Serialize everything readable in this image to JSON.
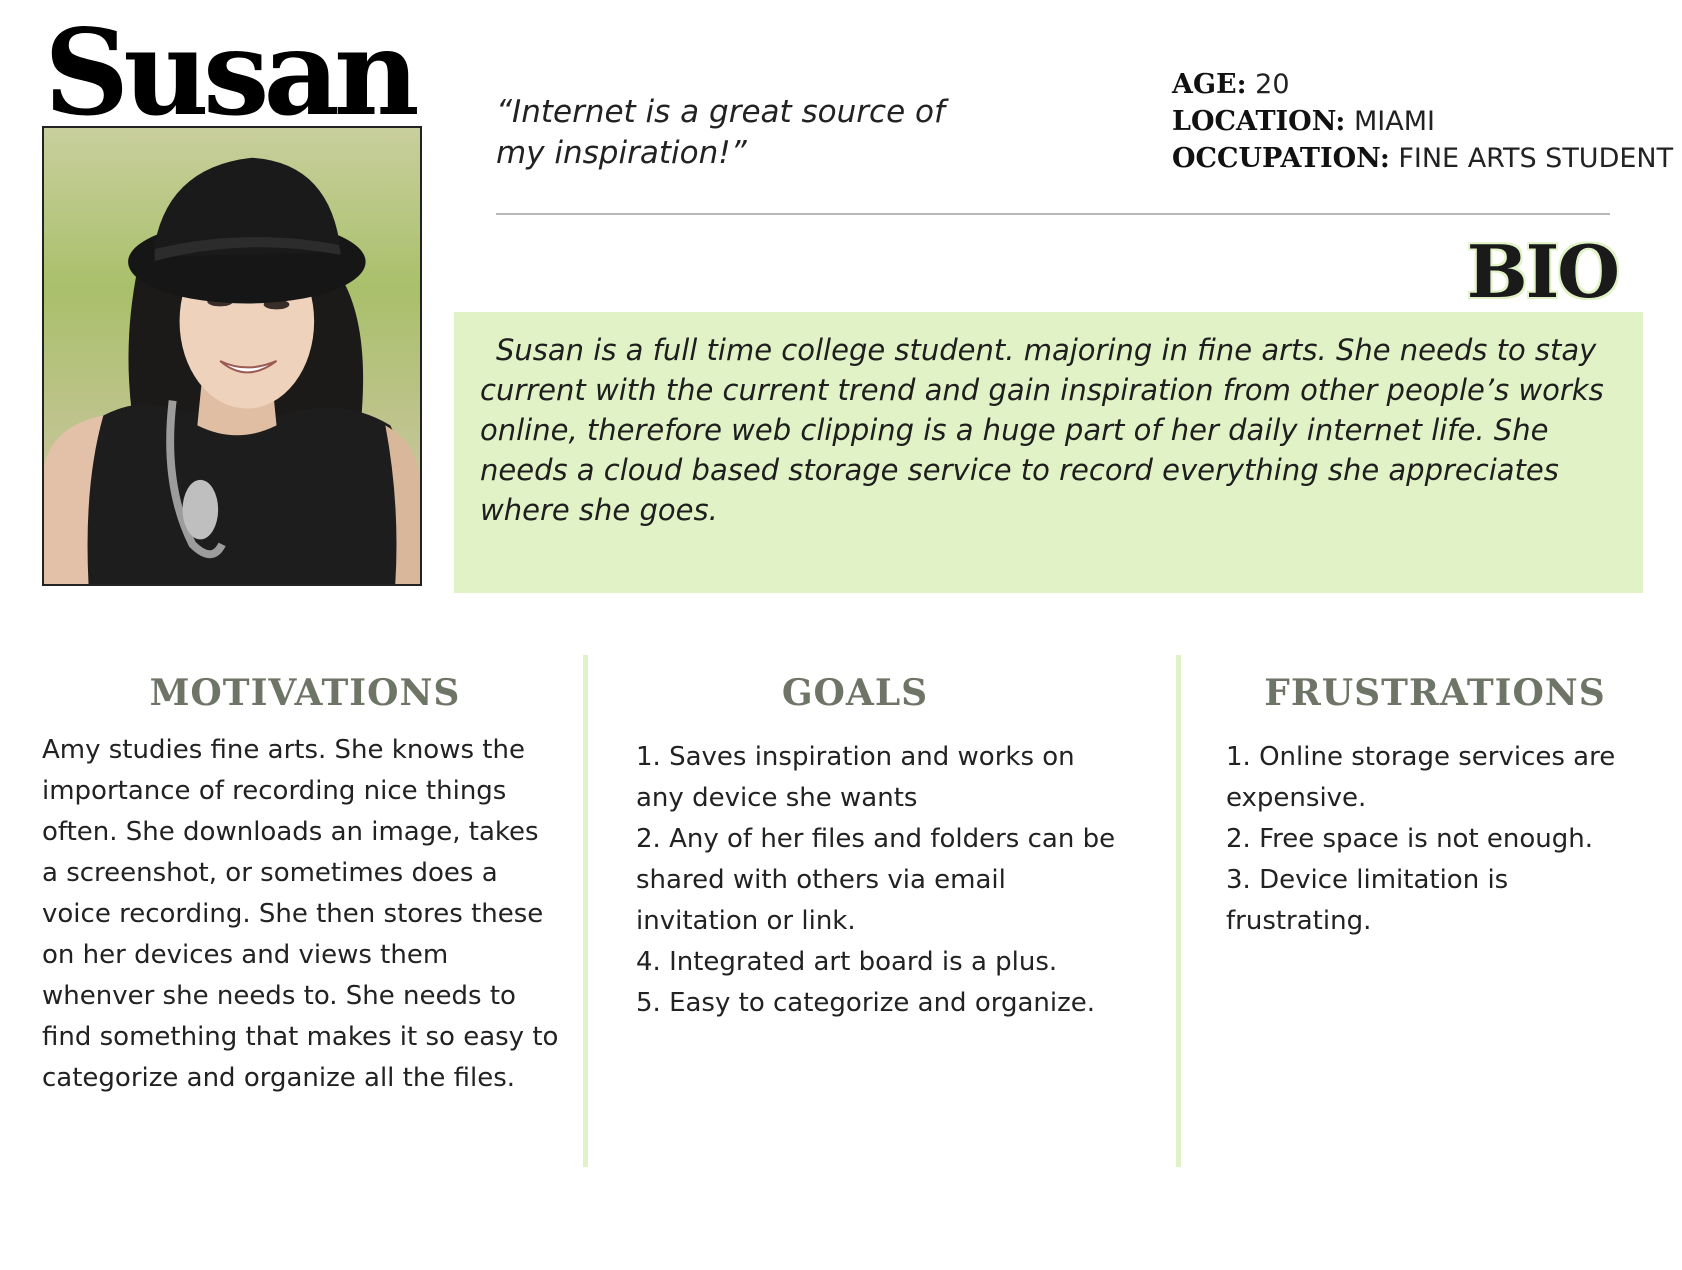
{
  "persona": {
    "name": "Susan",
    "quote": "“Internet is a great source of my inspiration!”",
    "stats": [
      {
        "key": "AGE:",
        "value": " 20"
      },
      {
        "key": "LOCATION:",
        "value": " MIAMI"
      },
      {
        "key": "OCCUPATION:",
        "value": " FINE ARTS STUDENT"
      }
    ],
    "photo_alt": "portrait-photo"
  },
  "bio": {
    "title": "BIO",
    "text": "Susan  is a full time college student. majoring in fine arts. She needs to stay current with the current trend and gain inspiration from other people’s works online,  therefore web clipping is a huge part of her daily internet life. She needs a cloud based storage service to record everything she appreciates where she goes."
  },
  "motivations": {
    "title": "MOTIVATIONS",
    "text": "Amy studies fine arts. She knows the importance of recording nice things often. She downloads an image, takes a screenshot, or sometimes does a voice recording. She then stores these on her devices and views them whenver she needs to. She needs to find something that makes it so easy to categorize and organize all the files."
  },
  "goals": {
    "title": "GOALS",
    "items": [
      "1. Saves inspiration and works on any device she wants",
      "2. Any of her files and folders can be shared with others via email invitation or link.",
      "4. Integrated art board is a plus.",
      "5. Easy to categorize and organize."
    ]
  },
  "frustrations": {
    "title": "FRUSTRATIONS",
    "items": [
      "1. Online storage services are expensive.",
      "2. Free space is not enough.",
      "3. Device limitation is frustrating."
    ]
  },
  "colors": {
    "accent_green": "#e1f3c6",
    "heading_gray": "#6f7566"
  }
}
